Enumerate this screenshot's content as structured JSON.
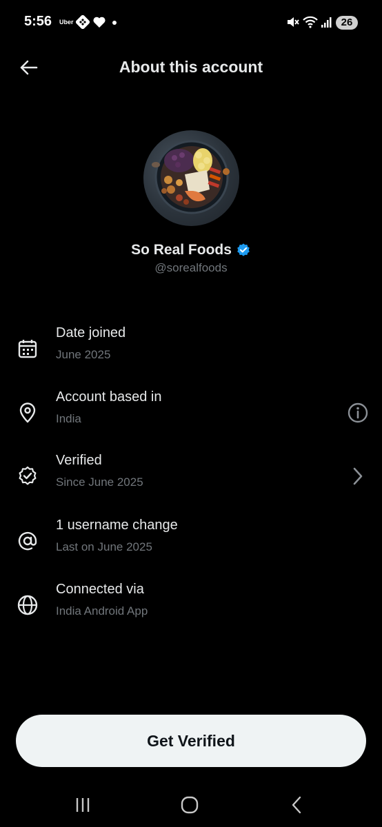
{
  "status_bar": {
    "time": "5:56",
    "uber_label": "Uber",
    "battery": "26",
    "icons": [
      "dice-icon",
      "heart-icon",
      "dot-icon",
      "mute-icon",
      "wifi-icon",
      "signal-icon",
      "battery-icon"
    ]
  },
  "header": {
    "title": "About this account",
    "back_icon": "arrow-left-icon"
  },
  "profile": {
    "display_name": "So Real Foods",
    "handle": "@sorealfoods",
    "verified_badge_color": "#1d9bf0"
  },
  "rows": [
    {
      "title": "Date joined",
      "subtitle": "June 2025",
      "icon": "calendar-icon"
    },
    {
      "title": "Account based in",
      "subtitle": "India",
      "icon": "location-pin-icon",
      "action_icon": "info-icon"
    },
    {
      "title": "Verified",
      "subtitle": "Since June 2025",
      "icon": "verified-badge-icon",
      "action_icon": "chevron-right-icon"
    },
    {
      "title": "1 username change",
      "subtitle": "Last on June 2025",
      "icon": "at-sign-icon"
    },
    {
      "title": "Connected via",
      "subtitle": "India Android App",
      "icon": "globe-icon"
    }
  ],
  "cta": {
    "label": "Get Verified"
  },
  "nav_bar": {
    "icons": [
      "recent-apps-icon",
      "home-icon",
      "back-icon"
    ]
  },
  "colors": {
    "background": "#000000",
    "primary_text": "#e7e9ea",
    "secondary_text": "#71767b",
    "button_bg": "#eff3f4",
    "accent": "#1d9bf0"
  }
}
